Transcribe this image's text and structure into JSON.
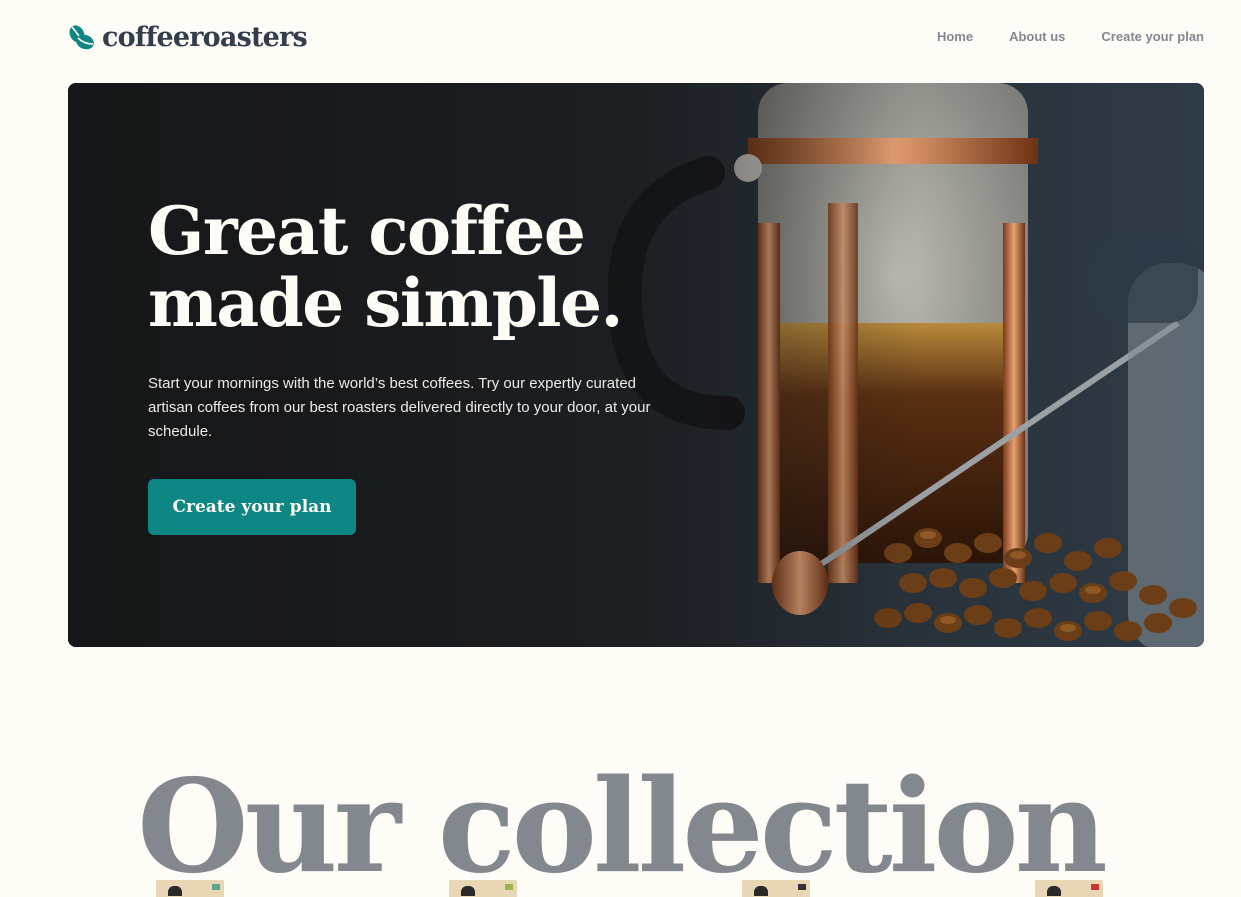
{
  "brand": {
    "name": "coffeeroasters",
    "logo_icon": "coffee-bean-icon",
    "accent": "#0E8784",
    "dark": "#333D4B",
    "grey": "#83888F",
    "background": "#FEFCF7"
  },
  "nav": {
    "items": [
      {
        "label": "Home"
      },
      {
        "label": "About us"
      },
      {
        "label": "Create your plan"
      }
    ]
  },
  "hero": {
    "title_line1": "Great coffee",
    "title_line2": "made simple.",
    "description": "Start your mornings with the world’s best coffees. Try our expertly curated artisan coffees from our best roasters delivered directly to your door, at your schedule.",
    "cta_label": "Create your plan",
    "image": "french-press-with-coffee-beans-photo"
  },
  "collection": {
    "title": "Our collection",
    "products": [
      {
        "image": "coffee-bag-1"
      },
      {
        "image": "coffee-bag-2"
      },
      {
        "image": "coffee-bag-3"
      },
      {
        "image": "coffee-bag-4"
      }
    ]
  }
}
